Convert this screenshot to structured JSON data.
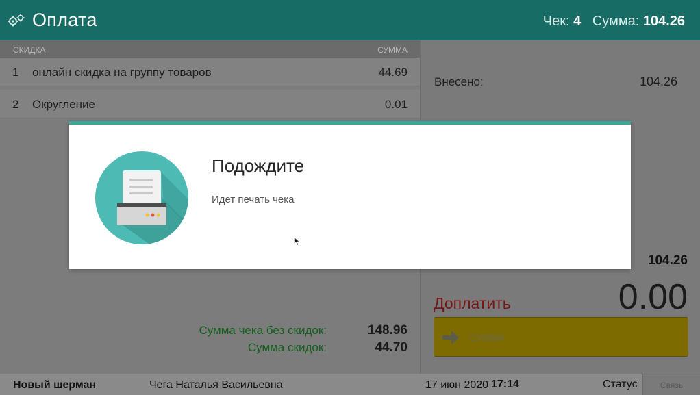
{
  "header": {
    "title": "Оплата",
    "gear_icon": "gears-icon",
    "receipt_label": "Чек:",
    "receipt_number": "4",
    "sum_label": "Сумма:",
    "sum_value": "104.26"
  },
  "discounts": {
    "col_discount": "СКИДКА",
    "col_sum": "СУММА",
    "rows": [
      {
        "num": "1",
        "name": "онлайн скидка на группу товаров",
        "value": "44.69"
      },
      {
        "num": "2",
        "name": "Округление",
        "value": "0.01"
      }
    ],
    "total_no_discount_label": "Сумма чека без скидок:",
    "total_no_discount_value": "148.96",
    "total_discount_label": "Сумма скидок:",
    "total_discount_value": "44.70"
  },
  "payment": {
    "paid_label": "Внесено:",
    "paid_value": "104.26",
    "subtotal_value": "104.26",
    "due_label": "Доплатить",
    "due_value": "0.00",
    "sum_button_label": "СУММА",
    "sum_button_icon": "arrow-right-icon"
  },
  "footer": {
    "shop": "Новый шерман",
    "cashier": "Чега Наталья Васильевна",
    "date": "17 июн 2020",
    "time": "17:14",
    "status": "Статус",
    "connection": "Связь"
  },
  "modal": {
    "title": "Подождите",
    "message": "Идет печать чека",
    "icon": "printer-icon"
  },
  "colors": {
    "header": "#176d66",
    "modal_accent": "#3aa597",
    "due_label": "#7a1515",
    "sum_button": "#7d6b00",
    "totals_label": "#145f1d"
  }
}
